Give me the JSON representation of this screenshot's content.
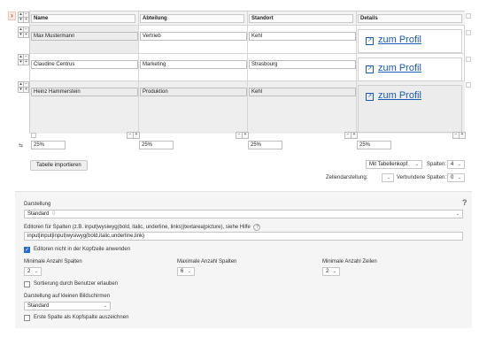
{
  "header_row": {
    "name": "Name",
    "abteilung": "Abteilung",
    "standort": "Standort",
    "details": "Details"
  },
  "rows": [
    {
      "name": "Max Mustermann",
      "abteilung": "Vertrieb",
      "standort": "Kehl",
      "link": "zum Profil"
    },
    {
      "name": "Claudine Centrus",
      "abteilung": "Marketing",
      "standort": "Strasbourg",
      "link": "zum Profil"
    },
    {
      "name": "Heinz Hammerstein",
      "abteilung": "Produktion",
      "standort": "Kehl",
      "link": "zum Profil"
    }
  ],
  "widths": [
    "25%",
    "25%",
    "25%",
    "25%"
  ],
  "glyphs": {
    "chevron": "›",
    "up": "▴",
    "down": "▾",
    "swap": "⇆",
    "minus": "−",
    "plus": "+",
    "link": "↗",
    "check": "✓",
    "drop": "⌄",
    "help": "?"
  },
  "toolbar": {
    "import_button": "Tabelle importieren",
    "header_mode": "Mit Tabellenkopf",
    "cols_label": "Spalten:",
    "cols_value": "4",
    "cell_label": "Zellendarstellung:",
    "cell_value": "",
    "merged_label": "Verbundene Spalten:",
    "merged_value": "0"
  },
  "settings": {
    "darstellung_label": "Darstellung",
    "darstellung_value": "Standard",
    "darstellung_hint": "0",
    "editors_label": "Editoren für Spalten (z.B. input|wysiwyg(bold, italic, underline, links)|textarea|picture), siehe Hilfe",
    "editors_value": "input|input|input|wysiwyg(bold,italic,underline,link)",
    "editors_header_cb": "Editoren nicht in der Kopfzeile anwenden",
    "editors_header_checked": true,
    "min_cols_label": "Minimale Anzahl Spalten",
    "min_cols_value": "2",
    "max_cols_label": "Maximale Anzahl Spalten",
    "max_cols_value": "6",
    "min_rows_label": "Minimale Anzahl Zeilen",
    "min_rows_value": "2",
    "sort_cb": "Sortierung durch Benutzer erlauben",
    "small_label": "Darstellung auf kleinen Bildschirmen",
    "small_value": "Standard",
    "first_col_cb": "Erste Spalte als Kopfspalte auszeichnen"
  }
}
